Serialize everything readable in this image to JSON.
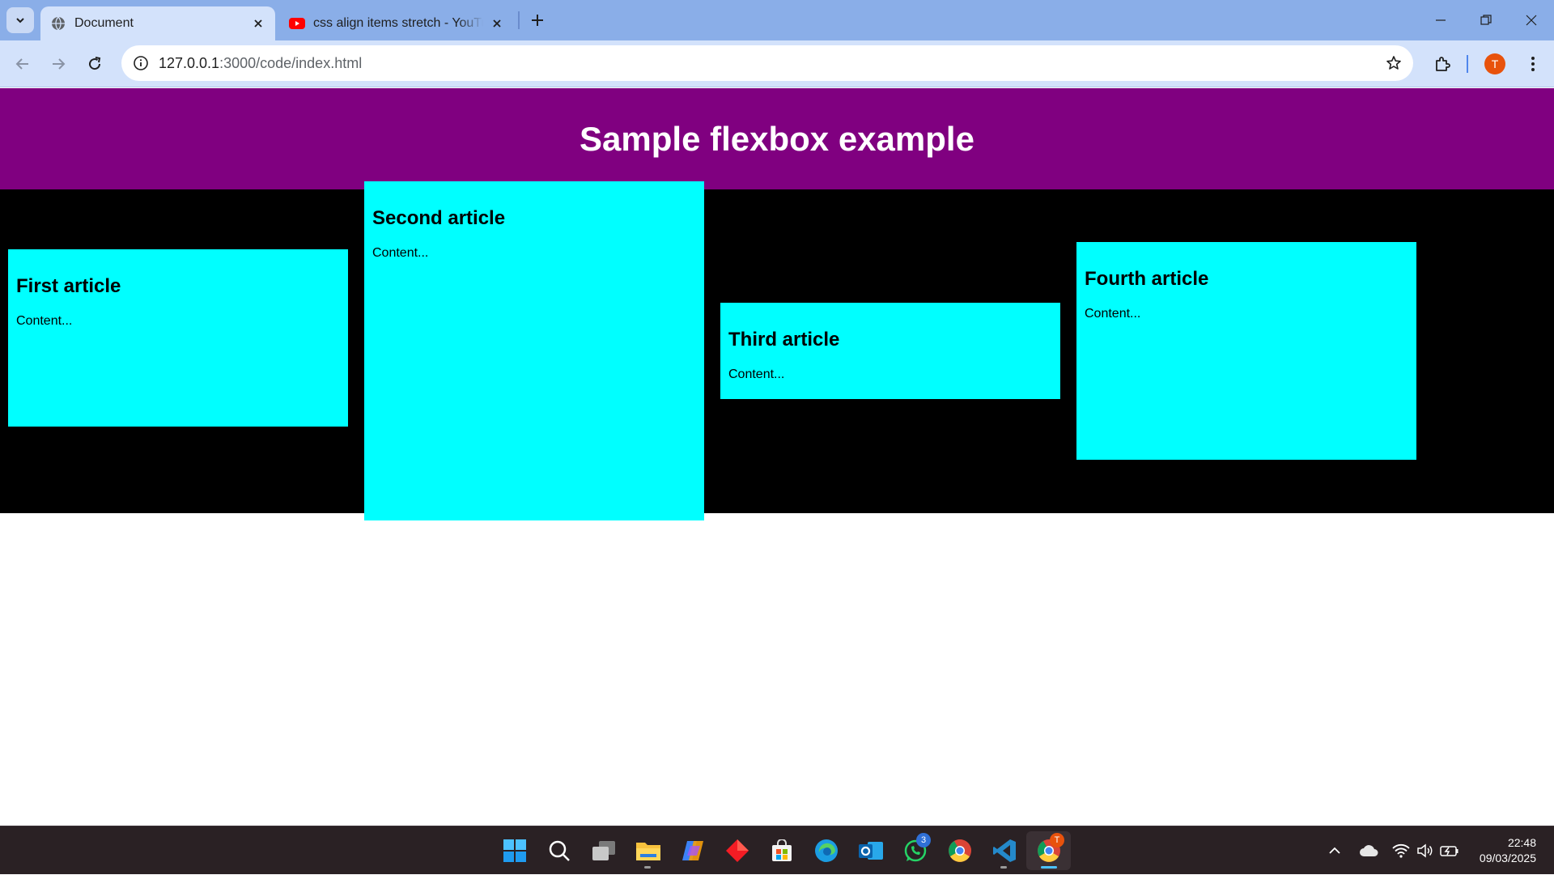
{
  "browser": {
    "tabs": [
      {
        "title": "Document",
        "active": true
      },
      {
        "title": "css align items stretch - YouTube",
        "active": false
      }
    ],
    "url": {
      "host": "127.0.0.1",
      "path": ":3000/code/index.html"
    },
    "profile_initial": "T"
  },
  "page": {
    "header_title": "Sample flexbox example",
    "colors": {
      "header_bg": "#800080",
      "section_bg": "#000000",
      "article_bg": "#00ffff"
    },
    "articles": [
      {
        "title": "First article",
        "content": "Content..."
      },
      {
        "title": "Second article",
        "content": "Content..."
      },
      {
        "title": "Third article",
        "content": "Content..."
      },
      {
        "title": "Fourth article",
        "content": "Content..."
      }
    ]
  },
  "taskbar": {
    "apps": [
      "start-icon",
      "search-icon",
      "task-view-icon",
      "file-explorer-icon",
      "copilot-icon",
      "git-app-icon",
      "microsoft-store-icon",
      "edge-icon",
      "outlook-icon",
      "whatsapp-icon",
      "chrome-icon",
      "vscode-icon",
      "chrome-profile-icon"
    ],
    "whatsapp_badge": "3",
    "chrome_profile_badge": "T",
    "time": "22:48",
    "date": "09/03/2025"
  }
}
